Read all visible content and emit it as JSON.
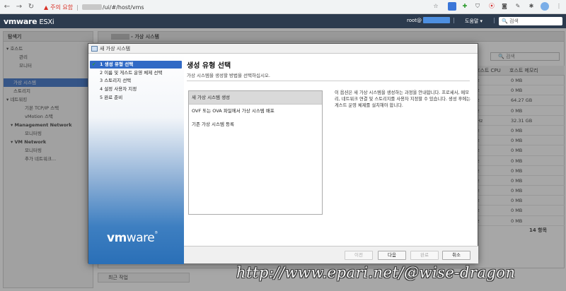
{
  "browser": {
    "warning_label": "주의 요함",
    "url_path": "/ui/#/host/vms"
  },
  "esxi": {
    "logo_brand": "vmware",
    "logo_product": "ESXi",
    "user_prefix": "root@",
    "help_label": "도움말 ▾",
    "search_label": "검색"
  },
  "navigator": {
    "title": "탐색기",
    "items": [
      {
        "label": "▾ 호스트",
        "indent": 4,
        "selected": false,
        "bold": false
      },
      {
        "label": "관리",
        "indent": 22,
        "selected": false,
        "bold": false
      },
      {
        "label": "모니터",
        "indent": 22,
        "selected": false,
        "bold": false
      },
      {
        "label": "",
        "indent": 0,
        "selected": false,
        "bold": false
      },
      {
        "label": "가상 시스템",
        "indent": 14,
        "selected": true,
        "bold": false
      },
      {
        "label": "스토리지",
        "indent": 14,
        "selected": false,
        "bold": false
      },
      {
        "label": "▾ 네트워킹",
        "indent": 4,
        "selected": false,
        "bold": false
      },
      {
        "label": "기본 TCP/IP 스택",
        "indent": 30,
        "selected": false,
        "bold": false
      },
      {
        "label": "vMotion 스택",
        "indent": 30,
        "selected": false,
        "bold": false
      },
      {
        "label": "▾ Management Network",
        "indent": 10,
        "selected": false,
        "bold": true
      },
      {
        "label": "모니터링",
        "indent": 30,
        "selected": false,
        "bold": false
      },
      {
        "label": "▾ VM Network",
        "indent": 10,
        "selected": false,
        "bold": true
      },
      {
        "label": "모니터링",
        "indent": 30,
        "selected": false,
        "bold": false
      },
      {
        "label": "추가 네트워크...",
        "indent": 30,
        "selected": false,
        "bold": false
      }
    ]
  },
  "main": {
    "title_suffix": "- 가상 시스템",
    "search_label": "검색",
    "columns": [
      "호스트 CPU",
      "호스트 메모리"
    ],
    "rows": [
      {
        "cpu": "z",
        "mem": "0 MB"
      },
      {
        "cpu": "z",
        "mem": "0 MB"
      },
      {
        "cpu": "z",
        "mem": "64.27 GB"
      },
      {
        "cpu": "z",
        "mem": "0 MB"
      },
      {
        "cpu": "Hz",
        "mem": "32.31 GB"
      },
      {
        "cpu": "z",
        "mem": "0 MB"
      },
      {
        "cpu": "z",
        "mem": "0 MB"
      },
      {
        "cpu": "z",
        "mem": "0 MB"
      },
      {
        "cpu": "z",
        "mem": "0 MB"
      },
      {
        "cpu": "z",
        "mem": "0 MB"
      },
      {
        "cpu": "z",
        "mem": "0 MB"
      },
      {
        "cpu": "z",
        "mem": "0 MB"
      },
      {
        "cpu": "z",
        "mem": "0 MB"
      },
      {
        "cpu": "z",
        "mem": "0 MB"
      },
      {
        "cpu": "z",
        "mem": "0 MB"
      }
    ],
    "count": "14 항목",
    "recent_tasks": "최근 작업"
  },
  "dialog": {
    "title": "새 가상 시스템",
    "steps": [
      "1 생성 유형 선택",
      "2 이름 및 게스트 운영 체제 선택",
      "3 스토리지 선택",
      "4 설정 사용자 지정",
      "5 완료 준비"
    ],
    "heading": "생성 유형 선택",
    "subheading": "가상 시스템을 생성할 방법을 선택하십시오.",
    "types": [
      "새 가상 시스템 생성",
      "OVF 또는 OVA 파일에서 가상 시스템 배포",
      "기존 가상 시스템 등록"
    ],
    "description": "이 옵션은 새 가상 시스템을 생성하는 과정을 안내합니다. 프로세서, 메모리, 네트워크 연결 및 스토리지를 사용자 지정할 수 있습니다. 생성 후에는 게스트 운영 체제를 설치해야 합니다.",
    "logo_vm": "vm",
    "logo_ware": "ware",
    "buttons": {
      "back": "이전",
      "next": "다음",
      "finish": "완료",
      "cancel": "취소"
    }
  },
  "watermark": "http://www.epari.net/@wise-dragon"
}
